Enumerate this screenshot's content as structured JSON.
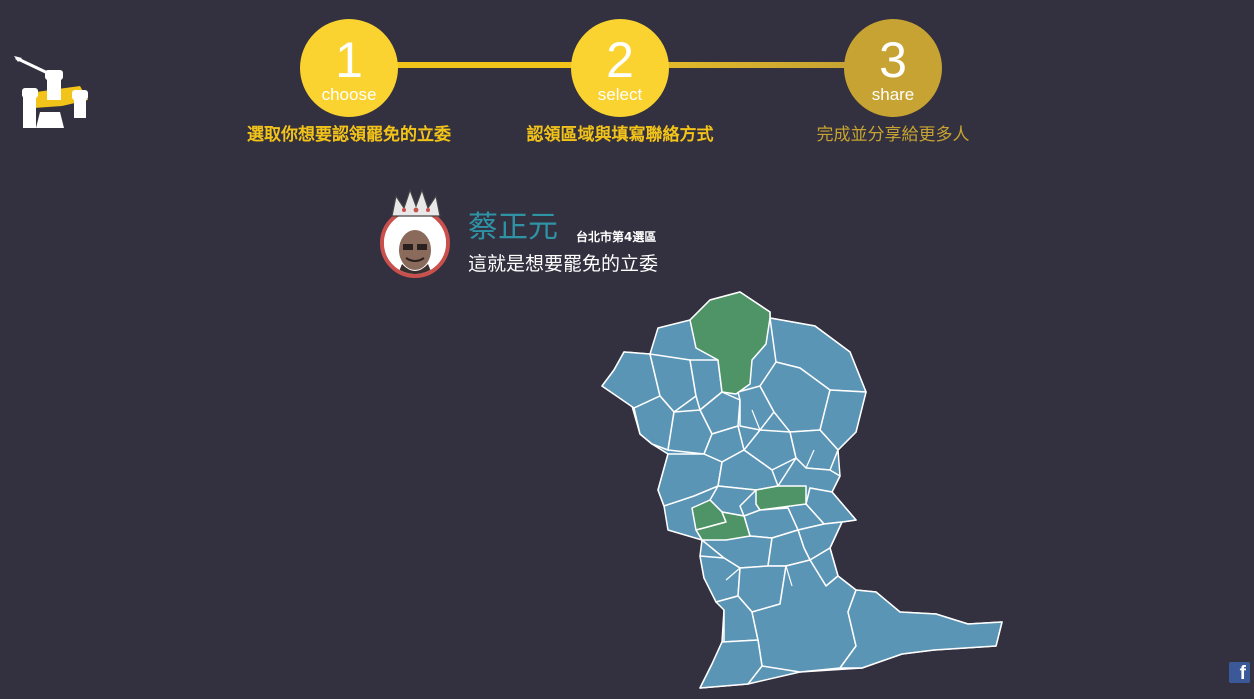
{
  "steps": [
    {
      "number": "1",
      "word": "choose",
      "label": "選取你想要認領罷免的立委",
      "color": "#fbd330"
    },
    {
      "number": "2",
      "word": "select",
      "label": "認領區域與填寫聯絡方式",
      "color": "#fbd330"
    },
    {
      "number": "3",
      "word": "share",
      "label": "完成並分享給更多人",
      "color": "#c6a332"
    }
  ],
  "candidate": {
    "name": "蔡正元",
    "district": "台北市第4選區",
    "description": "這就是想要罷免的立委"
  },
  "map": {
    "district_color": "#5b95b6",
    "selected_color": "#4f9466"
  },
  "icons": {
    "logo": "raised-fists-logo-icon",
    "facebook": "facebook-icon"
  },
  "colors": {
    "background": "#33303f",
    "accent": "#f2c318",
    "name": "#2f93a6",
    "avatar_ring": "#c9504c"
  }
}
